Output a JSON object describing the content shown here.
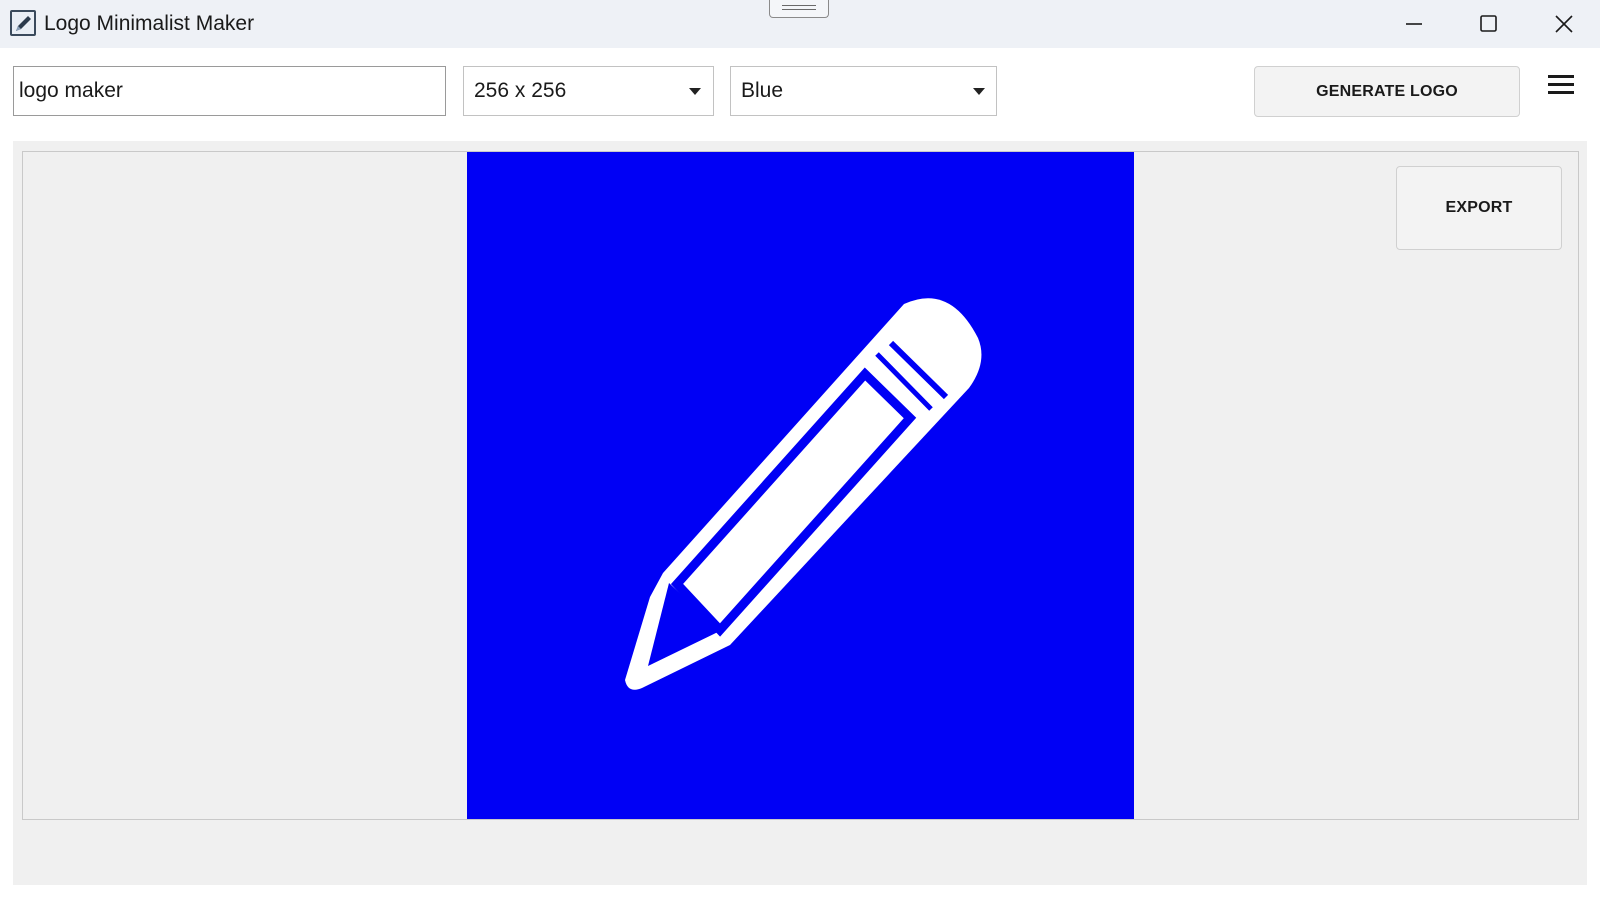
{
  "window": {
    "title": "Logo Minimalist Maker",
    "app_icon": "pencil-paper-icon",
    "controls": {
      "minimize_icon": "minimize-icon",
      "maximize_icon": "maximize-icon",
      "close_icon": "close-icon"
    }
  },
  "toolbar": {
    "prompt_value": "logo maker",
    "size_selected": "256 x 256",
    "color_selected": "Blue",
    "generate_label": "GENERATE LOGO",
    "menu_icon": "hamburger-menu-icon"
  },
  "preview": {
    "export_label": "EXPORT",
    "logo_icon": "pencil-icon",
    "logo_background_color": "#0000F5",
    "logo_foreground_color": "#FFFFFF"
  }
}
